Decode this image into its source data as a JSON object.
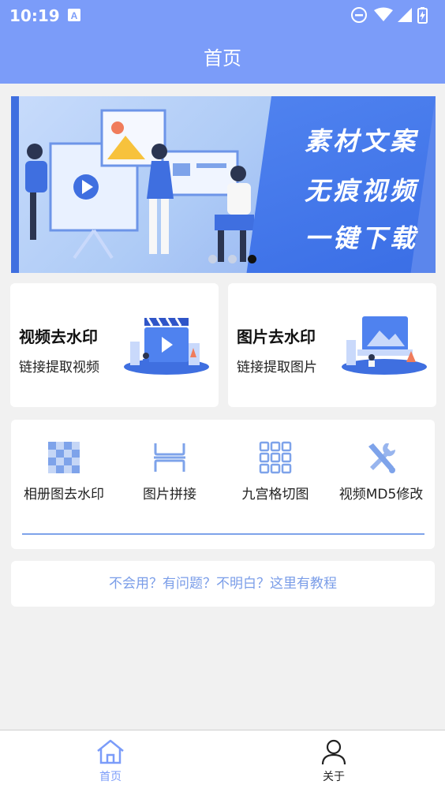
{
  "status_bar": {
    "time": "10:19"
  },
  "app_bar": {
    "title": "首页"
  },
  "banner": {
    "lines": [
      "素材文案",
      "无痕视频",
      "一键下载"
    ],
    "page_count": 3,
    "active_page": 3
  },
  "feature_cards": [
    {
      "title": "视频去水印",
      "subtitle": "链接提取视频",
      "icon": "video-clapper-illustration"
    },
    {
      "title": "图片去水印",
      "subtitle": "链接提取图片",
      "icon": "image-illustration"
    }
  ],
  "tools": [
    {
      "label": "相册图去水印",
      "icon": "checker-icon"
    },
    {
      "label": "图片拼接",
      "icon": "stitch-icon"
    },
    {
      "label": "九宫格切图",
      "icon": "grid-icon"
    },
    {
      "label": "视频MD5修改",
      "icon": "tools-icon"
    }
  ],
  "help": {
    "text": "不会用？有问题？不明白？这里有教程"
  },
  "bottom_nav": [
    {
      "label": "首页",
      "icon": "home-icon",
      "active": true
    },
    {
      "label": "关于",
      "icon": "person-icon",
      "active": false
    }
  ],
  "colors": {
    "primary": "#7b9cf9",
    "accent": "#3f6fe0",
    "help_text": "#7a9de8",
    "nav_active": "#7b9cf9",
    "nav_inactive": "#222222"
  }
}
